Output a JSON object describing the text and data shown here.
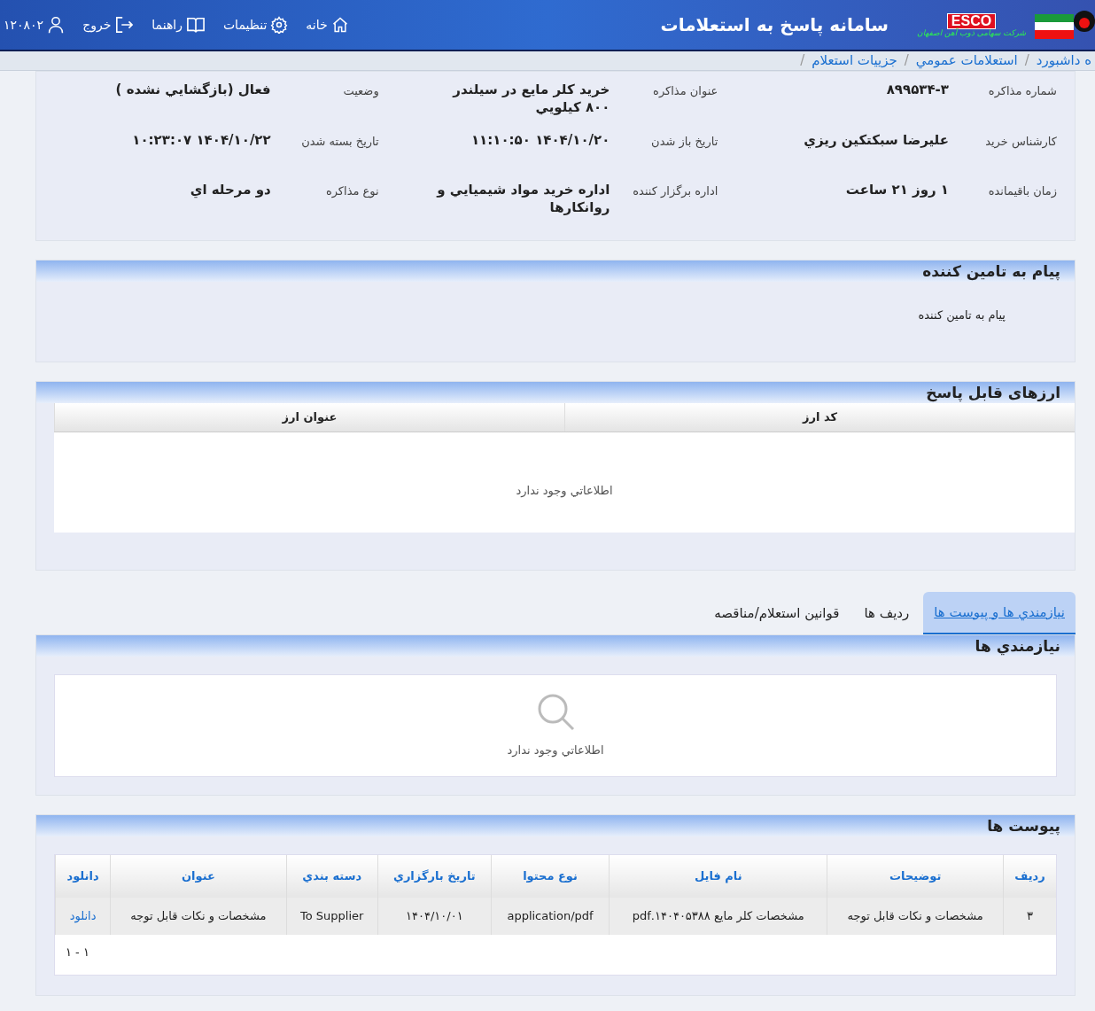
{
  "header": {
    "title": "سامانه پاسخ به استعلامات",
    "logo": {
      "brand": "ESCO",
      "company": "شرکت سهامی ذوب آهن اصفهان"
    },
    "nav": [
      {
        "kind": "home",
        "label": "خانه"
      },
      {
        "kind": "settings",
        "label": "تنظيمات"
      },
      {
        "kind": "guide",
        "label": "راهنما"
      },
      {
        "kind": "logout",
        "label": "خروج"
      },
      {
        "kind": "user",
        "label": "۱۲۰۸۰۲"
      }
    ]
  },
  "breadcrumb": {
    "separator": "/",
    "items": [
      "ه داشبورد",
      "استعلامات عمومي",
      "جزييات استعلام"
    ]
  },
  "details": [
    {
      "label": "شماره مذاكره",
      "value": "۸۹۹۵۳۴-۳"
    },
    {
      "label": "عنوان مذاكره",
      "value": "خريد كلر مايع در سيلندر ۸۰۰ كيلويي"
    },
    {
      "label": "وضعيت",
      "value": "فعال (بازگشايي نشده )"
    },
    {
      "label": "كارشناس خريد",
      "value": "عليرضا سبكتكين ريزي"
    },
    {
      "label": "تاريخ باز شدن",
      "value": "۱۴۰۴/۱۰/۲۰ ۱۱:۱۰:۵۰"
    },
    {
      "label": "تاريخ بسته شدن",
      "value": "۱۴۰۴/۱۰/۲۲ ۱۰:۲۳:۰۷"
    },
    {
      "label": "زمان باقيمانده",
      "value": "۱ روز ۲۱ ساعت"
    },
    {
      "label": "اداره برگزار كننده",
      "value": "اداره خريد مواد شيميايي و روانكارها"
    },
    {
      "label": "نوع مذاكره",
      "value": "دو مرحله اي"
    }
  ],
  "supplier_message": {
    "title": "پيام به تامين کننده",
    "text": "پيام به تامين کننده"
  },
  "currencies": {
    "title": "ارزهای قابل پاسخ",
    "columns": [
      "كد ارز",
      "عنوان ارز"
    ],
    "empty": "اطلاعاتي وجود ندارد"
  },
  "tabs": [
    {
      "label": "نيازمندي ها و پيوست ها",
      "selected": true
    },
    {
      "label": "رديف ها",
      "selected": false
    },
    {
      "label": "قوانين استعلام/مناقصه",
      "selected": false
    }
  ],
  "requirements": {
    "title": "نيازمندي ها",
    "empty": "اطلاعاتي وجود ندارد"
  },
  "attachments": {
    "title": "پيوست ها",
    "columns": [
      "رديف",
      "توضيحات",
      "نام فايل",
      "نوع محتوا",
      "تاريخ بارگزاري",
      "دسته بندي",
      "عنوان",
      "دانلود"
    ],
    "rows": [
      [
        "۳",
        "مشخصات و نكات قابل توجه",
        "مشخصات كلر مايع ۱۴۰۴۰۵۳۸۸.pdf",
        "application/pdf",
        "۱۴۰۴/۱۰/۰۱",
        "To Supplier",
        "مشخصات و نكات قابل توجه",
        "دانلود"
      ]
    ],
    "pager": "۱ - ۱"
  }
}
